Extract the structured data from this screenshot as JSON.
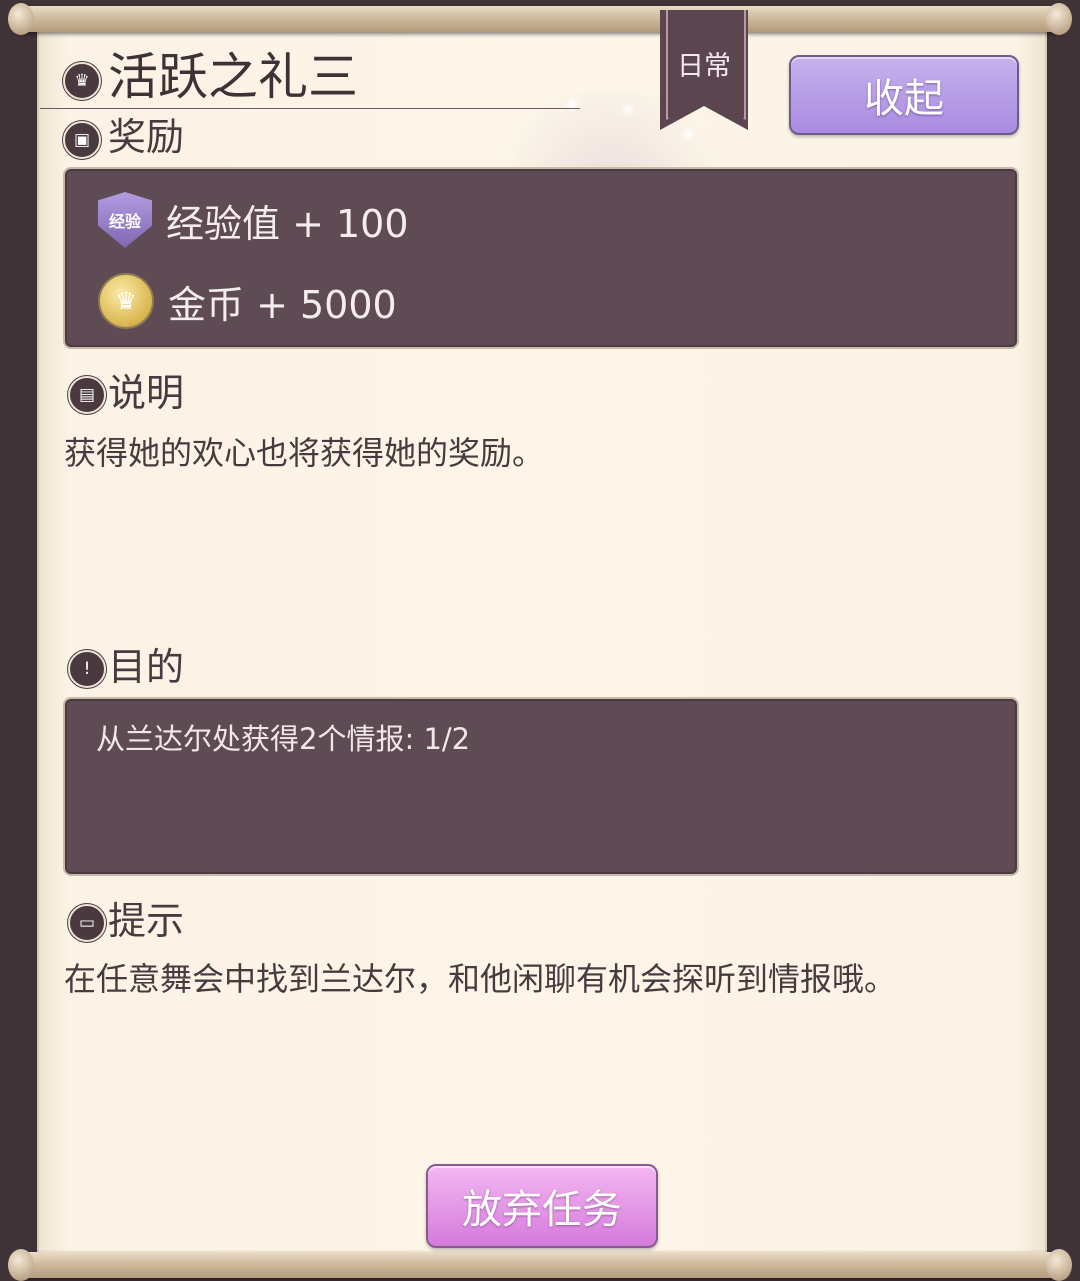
{
  "quest": {
    "title": "活跃之礼三",
    "category": "日常",
    "collapse_label": "收起"
  },
  "rewards": {
    "heading": "奖励",
    "items": [
      {
        "icon": "exp-badge-icon",
        "badge_text": "经验",
        "label": "经验值 + 100"
      },
      {
        "icon": "gold-coin-icon",
        "label": "金币 + 5000"
      }
    ]
  },
  "description": {
    "heading": "说明",
    "text": "获得她的欢心也将获得她的奖励。"
  },
  "objective": {
    "heading": "目的",
    "text": "从兰达尔处获得2个情报: 1/2"
  },
  "hint": {
    "heading": "提示",
    "text": "在任意舞会中找到兰达尔，和他闲聊有机会探听到情报哦。"
  },
  "footer": {
    "abandon_label": "放弃任务"
  },
  "colors": {
    "panel": "#5f4b54",
    "paper": "#fcf5e8",
    "collapse_button": "#b9a0e8",
    "abandon_button": "#e497e6"
  }
}
